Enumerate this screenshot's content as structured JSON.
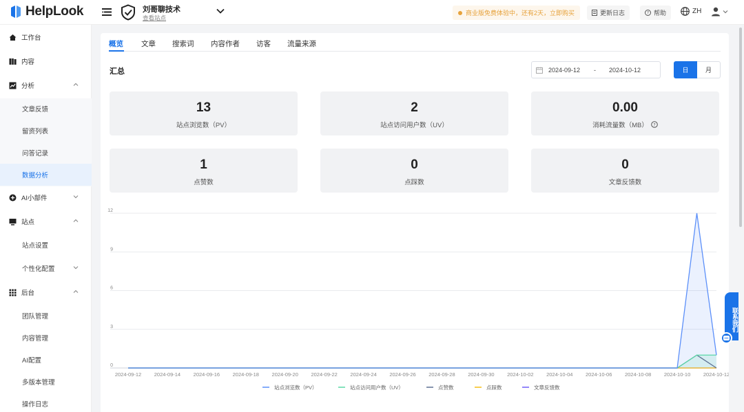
{
  "brand": {
    "name": "HelpLook"
  },
  "site": {
    "name": "刘哥聊技术",
    "link": "查看站点"
  },
  "header": {
    "promo": "商业版免费体验中，还有2天，立即购买",
    "changelog": "更新日志",
    "help": "帮助",
    "lang": "ZH"
  },
  "sidebar": {
    "items": [
      {
        "label": "工作台",
        "icon": "home-icon"
      },
      {
        "label": "内容",
        "icon": "book-icon"
      },
      {
        "label": "分析",
        "icon": "chart-icon"
      },
      {
        "label": "文章反馈"
      },
      {
        "label": "留资列表"
      },
      {
        "label": "问答记录"
      },
      {
        "label": "数据分析"
      },
      {
        "label": "AI小部件",
        "icon": "plus-circle-icon"
      },
      {
        "label": "站点",
        "icon": "monitor-icon"
      },
      {
        "label": "站点设置"
      },
      {
        "label": "个性化配置"
      },
      {
        "label": "后台",
        "icon": "grid-icon"
      },
      {
        "label": "团队管理"
      },
      {
        "label": "内容管理"
      },
      {
        "label": "AI配置"
      },
      {
        "label": "多版本管理"
      },
      {
        "label": "操作日志"
      }
    ]
  },
  "tabs": [
    "概览",
    "文章",
    "搜索词",
    "内容作者",
    "访客",
    "流量来源"
  ],
  "summary": {
    "title": "汇总",
    "date_start": "2024-09-12",
    "date_sep": "-",
    "date_end": "2024-10-12",
    "day": "日",
    "month": "月",
    "stats": [
      {
        "value": "13",
        "label": "站点浏览数（PV）"
      },
      {
        "value": "2",
        "label": "站点访问用户数（UV）"
      },
      {
        "value": "0.00",
        "label": "消耗流量数（MB）"
      },
      {
        "value": "1",
        "label": "点赞数"
      },
      {
        "value": "0",
        "label": "点踩数"
      },
      {
        "value": "0",
        "label": "文章反馈数"
      }
    ]
  },
  "contact": {
    "label": "联系我们"
  },
  "colors": {
    "accent": "#1a73e8",
    "pv": "#5b8ff9",
    "uv": "#5ad8a6",
    "like": "#5d7092",
    "dislike": "#f6bd16",
    "feedback": "#6f5ef9"
  },
  "chart_data": {
    "type": "line",
    "x": [
      "2024-09-12",
      "2024-09-13",
      "2024-09-14",
      "2024-09-15",
      "2024-09-16",
      "2024-09-17",
      "2024-09-18",
      "2024-09-19",
      "2024-09-20",
      "2024-09-21",
      "2024-09-22",
      "2024-09-23",
      "2024-09-24",
      "2024-09-25",
      "2024-09-26",
      "2024-09-27",
      "2024-09-28",
      "2024-09-29",
      "2024-09-30",
      "2024-10-01",
      "2024-10-02",
      "2024-10-03",
      "2024-10-04",
      "2024-10-05",
      "2024-10-06",
      "2024-10-07",
      "2024-10-08",
      "2024-10-09",
      "2024-10-10",
      "2024-10-11",
      "2024-10-12"
    ],
    "x_tick_labels": [
      "2024-09-12",
      "2024-09-14",
      "2024-09-16",
      "2024-09-18",
      "2024-09-20",
      "2024-09-22",
      "2024-09-24",
      "2024-09-26",
      "2024-09-28",
      "2024-09-30",
      "2024-10-02",
      "2024-10-04",
      "2024-10-06",
      "2024-10-08",
      "2024-10-10",
      "2024-10-12"
    ],
    "y_ticks": [
      0,
      3,
      6,
      9,
      12
    ],
    "ylim": [
      0,
      12
    ],
    "grid": true,
    "legend": "bottom",
    "series": [
      {
        "name": "站点浏览数（PV）",
        "values": [
          0,
          0,
          0,
          0,
          0,
          0,
          0,
          0,
          0,
          0,
          0,
          0,
          0,
          0,
          0,
          0,
          0,
          0,
          0,
          0,
          0,
          0,
          0,
          0,
          0,
          0,
          0,
          0,
          0,
          12,
          1
        ]
      },
      {
        "name": "站点访问用户数（UV）",
        "values": [
          0,
          0,
          0,
          0,
          0,
          0,
          0,
          0,
          0,
          0,
          0,
          0,
          0,
          0,
          0,
          0,
          0,
          0,
          0,
          0,
          0,
          0,
          0,
          0,
          0,
          0,
          0,
          0,
          0,
          1,
          1
        ]
      },
      {
        "name": "点赞数",
        "values": [
          0,
          0,
          0,
          0,
          0,
          0,
          0,
          0,
          0,
          0,
          0,
          0,
          0,
          0,
          0,
          0,
          0,
          0,
          0,
          0,
          0,
          0,
          0,
          0,
          0,
          0,
          0,
          0,
          0,
          1,
          0
        ]
      },
      {
        "name": "点踩数",
        "values": [
          0,
          0,
          0,
          0,
          0,
          0,
          0,
          0,
          0,
          0,
          0,
          0,
          0,
          0,
          0,
          0,
          0,
          0,
          0,
          0,
          0,
          0,
          0,
          0,
          0,
          0,
          0,
          0,
          0,
          0,
          0
        ]
      },
      {
        "name": "文章反馈数",
        "values": [
          0,
          0,
          0,
          0,
          0,
          0,
          0,
          0,
          0,
          0,
          0,
          0,
          0,
          0,
          0,
          0,
          0,
          0,
          0,
          0,
          0,
          0,
          0,
          0,
          0,
          0,
          0,
          0,
          0,
          0,
          0
        ]
      }
    ]
  }
}
